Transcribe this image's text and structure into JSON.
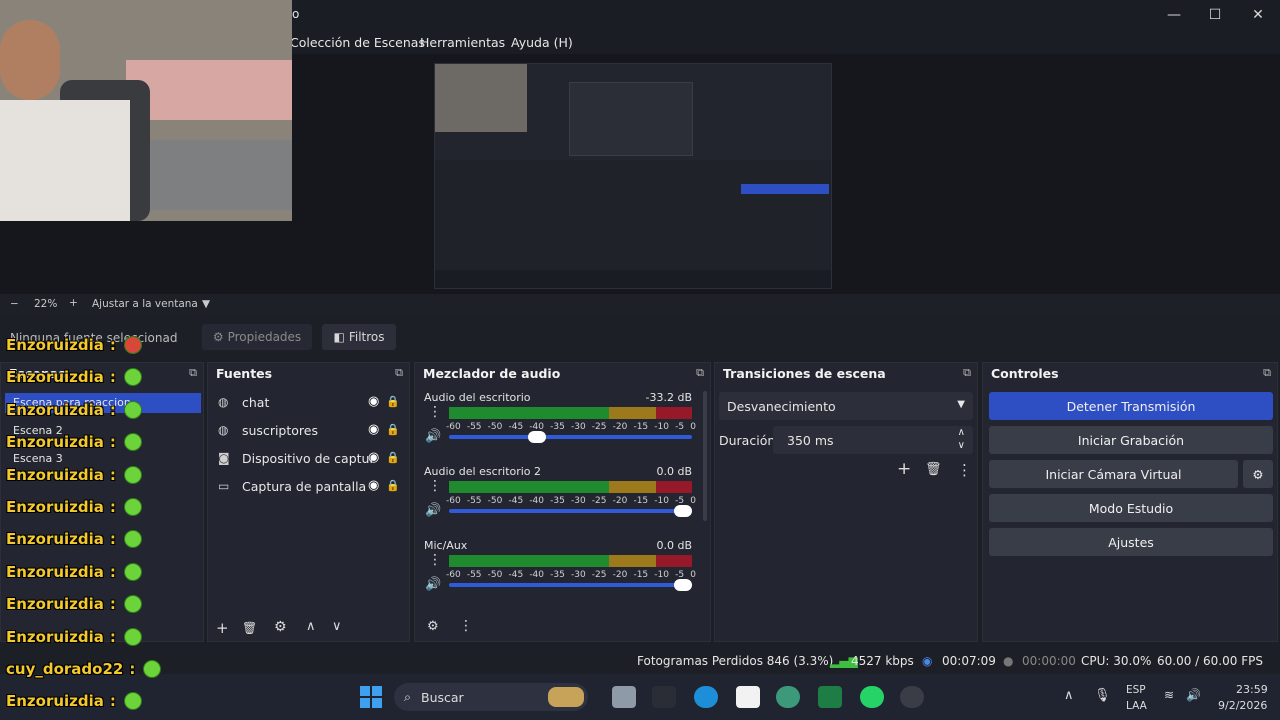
{
  "window": {
    "title_fragment": "o",
    "minimize": "—",
    "maximize": "☐",
    "close": "✕"
  },
  "menu": [
    "Colección de Escenas",
    "Herramientas",
    "Ayuda (H)"
  ],
  "zoom": {
    "minus": "−",
    "value": "22%",
    "plus": "+",
    "fit": "Ajustar a la ventana"
  },
  "toolbar": {
    "no_source": "Ninguna fuente seleccionad",
    "properties": "Propiedades",
    "filters": "Filtros"
  },
  "scenes": {
    "title": "Escenas",
    "items": [
      "Escena para reaccion",
      "Escena 2",
      "Escena 3"
    ]
  },
  "sources": {
    "title": "Fuentes",
    "items": [
      {
        "icon": "globe-icon",
        "label": "chat"
      },
      {
        "icon": "globe-icon",
        "label": "suscriptores"
      },
      {
        "icon": "camera-icon",
        "label": "Dispositivo de captur"
      },
      {
        "icon": "monitor-icon",
        "label": "Captura de pantalla"
      }
    ]
  },
  "mixer": {
    "title": "Mezclador de audio",
    "channels": [
      {
        "name": "Audio del escritorio",
        "db": "-33.2 dB",
        "volume": 0.35
      },
      {
        "name": "Audio del escritorio 2",
        "db": "0.0 dB",
        "volume": 1.0
      },
      {
        "name": "Mic/Aux",
        "db": "0.0 dB",
        "volume": 1.0
      }
    ],
    "ticks": [
      "-60",
      "-55",
      "-50",
      "-45",
      "-40",
      "-35",
      "-30",
      "-25",
      "-20",
      "-15",
      "-10",
      "-5",
      "0"
    ]
  },
  "transitions": {
    "title": "Transiciones de escena",
    "selected": "Desvanecimiento",
    "duration_label": "Duración",
    "duration_value": "350 ms"
  },
  "controls": {
    "title": "Controles",
    "buttons": [
      "Detener Transmisión",
      "Iniciar Grabación",
      "Iniciar Cámara Virtual",
      "Modo Estudio",
      "Ajustes"
    ],
    "accent": "#2e4ec4"
  },
  "status": {
    "frames": "Fotogramas Perdidos 846 (3.3%)",
    "bitrate": "4527 kbps",
    "stream_time": "00:07:09",
    "rec_time": "00:00:00",
    "cpu": "CPU: 30.0%",
    "fps": "60.00 / 60.00 FPS"
  },
  "chat": {
    "lines": [
      {
        "user": "Enzoruizdia",
        "sep": ":"
      },
      {
        "user": "Enzoruizdia",
        "sep": ":"
      },
      {
        "user": "Enzoruizdia",
        "sep": ":"
      },
      {
        "user": "Enzoruizdia",
        "sep": ":"
      },
      {
        "user": "Enzoruizdia",
        "sep": ":"
      },
      {
        "user": "Enzoruizdia",
        "sep": ":"
      },
      {
        "user": "Enzoruizdia",
        "sep": ":"
      },
      {
        "user": "Enzoruizdia",
        "sep": ":"
      },
      {
        "user": "Enzoruizdia",
        "sep": ":"
      },
      {
        "user": "Enzoruizdia",
        "sep": ":"
      },
      {
        "user": "cuy_dorado22",
        "sep": ":"
      },
      {
        "user": "Enzoruizdia",
        "sep": ":"
      }
    ]
  },
  "taskbar": {
    "search": "Buscar",
    "lang1": "ESP",
    "lang2": "LAA",
    "time": "23:59",
    "date": "9/2/2026"
  }
}
